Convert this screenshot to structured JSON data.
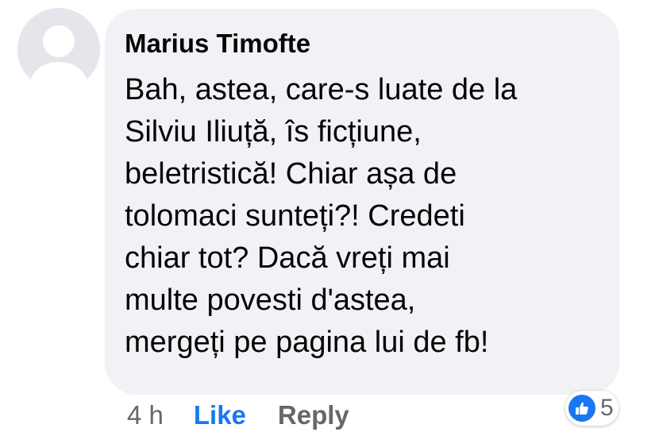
{
  "comment": {
    "author": "Marius Timofte",
    "text_lines": [
      "Bah, astea, care-s luate de la",
      "Silviu Iliuță, îs ficțiune,",
      "beletristică! Chiar așa de",
      "tolomaci sunteți?! Credeti",
      "chiar tot? Dacă vreți mai",
      "multe povesti d'astea,",
      "mergeți pe pagina lui de fb!"
    ],
    "timestamp": "4 h",
    "like_label": "Like",
    "reply_label": "Reply",
    "reaction_count": "5",
    "reaction_icon": "thumbs-up-icon"
  },
  "colors": {
    "bubble": "#f0f2f5",
    "like_blue": "#1877f2",
    "secondary_text": "#65676b",
    "primary_text": "#050505",
    "avatar_bg": "#e4e6eb",
    "avatar_silhouette": "#ffffff"
  }
}
